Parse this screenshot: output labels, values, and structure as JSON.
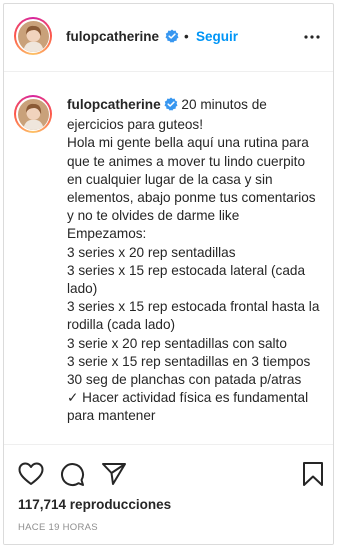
{
  "header": {
    "username": "fulopcatherine",
    "separator": "•",
    "follow_label": "Seguir"
  },
  "caption": {
    "username": "fulopcatherine",
    "text": " 20 minutos de ejercicios para guteos!\nHola mi gente bella aquí una rutina para que te animes a mover tu lindo cuerpito en cualquier lugar de la casa y sin elementos, abajo ponme tus comentarios y no te olvides de darme like\nEmpezamos:\n3 series x 20 rep sentadillas\n3 series x 15 rep estocada lateral (cada lado)\n3 series x 15 rep estocada frontal hasta la rodilla (cada lado)\n3 serie x 20 rep sentadillas con salto\n3 serie x 15 rep sentadillas en 3 tiempos\n30 seg de planchas con patada p/atras\n✓ Hacer actividad física es fundamental para mantener"
  },
  "stats": {
    "views": "117,714 reproducciones",
    "time": "HACE 19 HORAS"
  },
  "colors": {
    "accent": "#0095f6",
    "verified": "#3897f0",
    "text": "#262626",
    "muted": "#8e8e8e"
  },
  "icons": [
    "verified-badge-icon",
    "more-options-icon",
    "heart-icon",
    "comment-icon",
    "share-icon",
    "bookmark-icon"
  ]
}
